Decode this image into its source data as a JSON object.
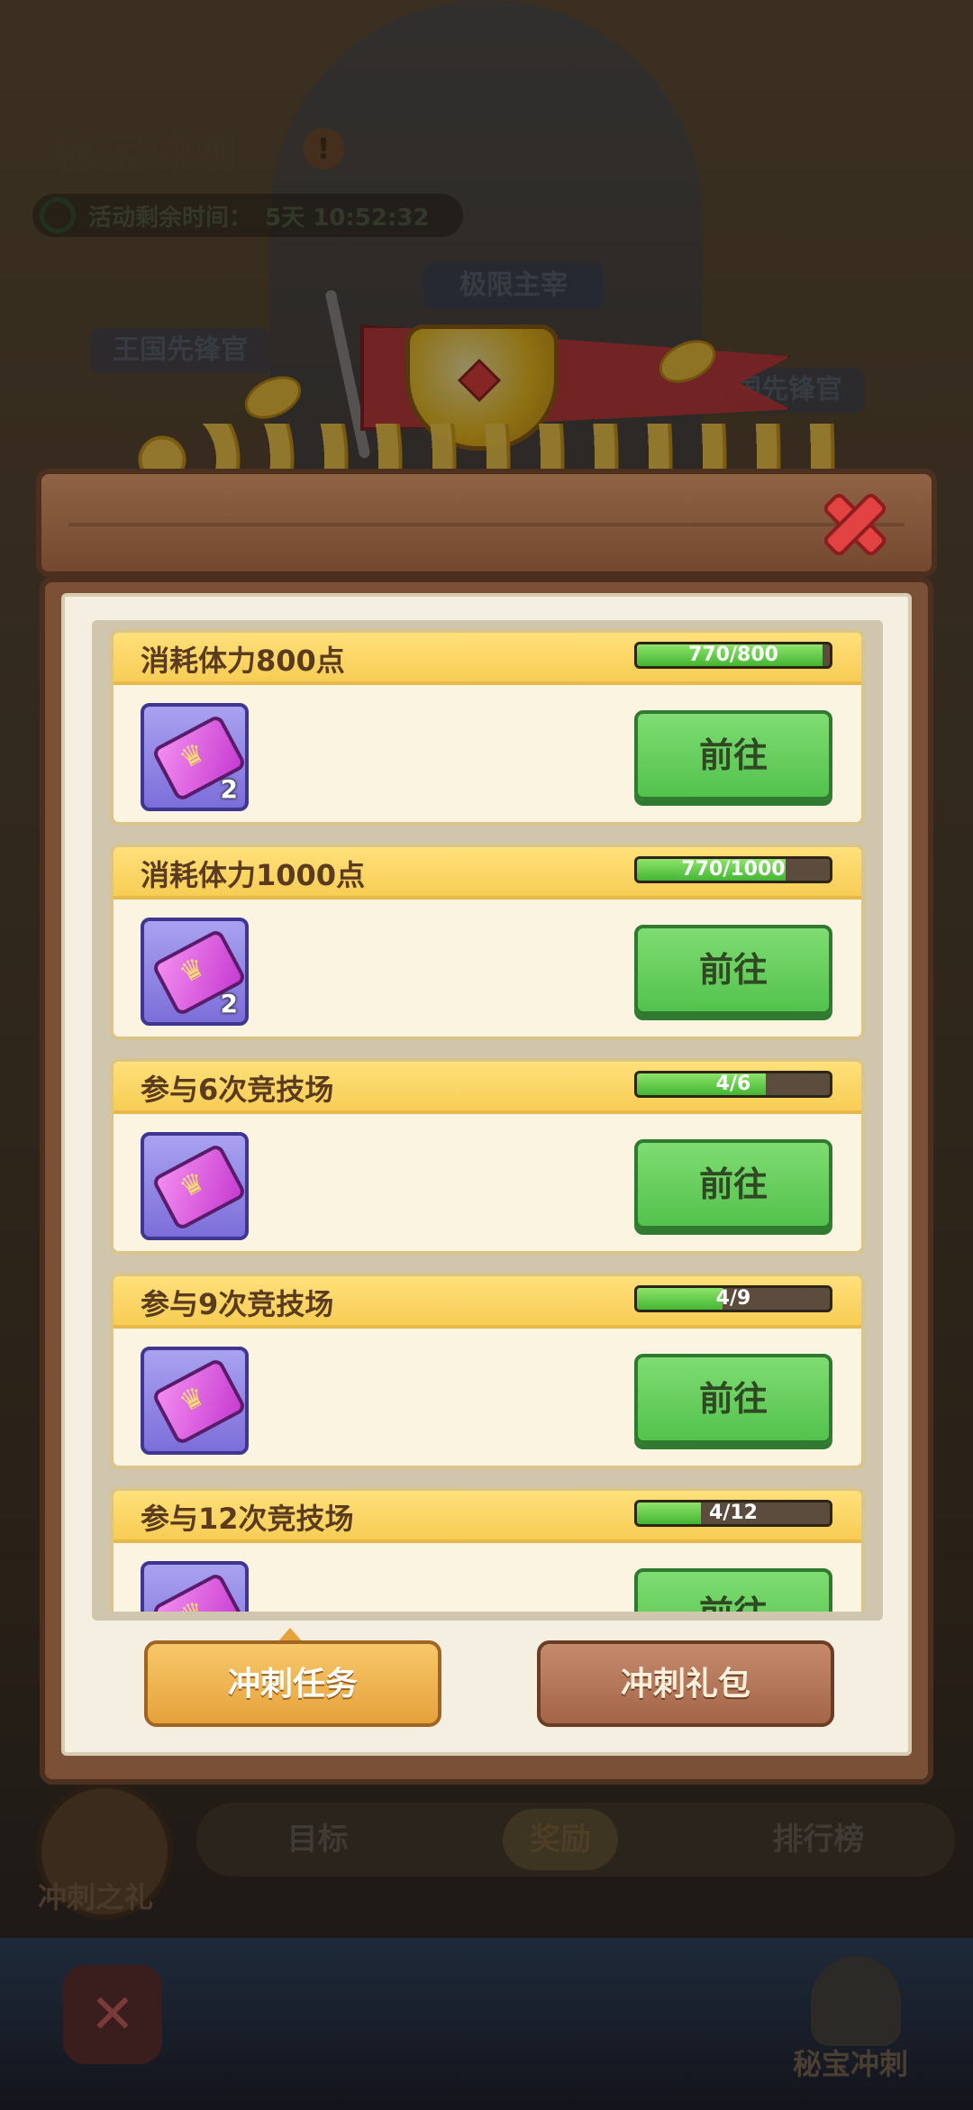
{
  "header": {
    "title": "秘宝冲刺",
    "timer_label": "活动剩余时间：",
    "timer_value": "5天 10:52:32"
  },
  "banners": {
    "top": "极限主宰",
    "left": "王国先锋官",
    "right": "王国先锋官"
  },
  "tasks": [
    {
      "title": "消耗体力800点",
      "progress_text": "770/800",
      "progress": 0.9625,
      "reward_count": "2",
      "button": "前往"
    },
    {
      "title": "消耗体力1000点",
      "progress_text": "770/1000",
      "progress": 0.77,
      "reward_count": "2",
      "button": "前往"
    },
    {
      "title": "参与6次竞技场",
      "progress_text": "4/6",
      "progress": 0.667,
      "reward_count": "",
      "button": "前往"
    },
    {
      "title": "参与9次竞技场",
      "progress_text": "4/9",
      "progress": 0.444,
      "reward_count": "",
      "button": "前往"
    },
    {
      "title": "参与12次竞技场",
      "progress_text": "4/12",
      "progress": 0.333,
      "reward_count": "",
      "button": "前往"
    }
  ],
  "modal_tabs": {
    "active": "冲刺任务",
    "inactive": "冲刺礼包"
  },
  "bottom": {
    "gift_label": "冲刺之礼",
    "tabs": [
      "目标",
      "奖励",
      "排行榜"
    ],
    "active_tab": "奖励",
    "right_label": "秘宝冲刺"
  },
  "colors": {
    "go_button": "#53c24d",
    "progress_fill": "#44b534",
    "header_yellow": "#f7cd55",
    "close_red": "#e34242"
  }
}
